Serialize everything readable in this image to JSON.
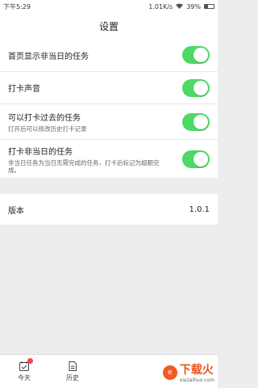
{
  "status": {
    "time": "下午5:29",
    "network_speed": "1.01K/s",
    "battery": "39%"
  },
  "header": {
    "title": "设置"
  },
  "settings": [
    {
      "title": "首页显示非当日的任务",
      "desc": "",
      "on": true
    },
    {
      "title": "打卡声音",
      "desc": "",
      "on": true
    },
    {
      "title": "可以打卡过去的任务",
      "desc": "打开后可以修改历史打卡记录",
      "on": true
    },
    {
      "title": "打卡非当日的任务",
      "desc": "非当日任务为当日无需完成的任务，打卡后标记为超额完成。",
      "on": true
    }
  ],
  "version": {
    "label": "版本",
    "value": "1.0.1"
  },
  "tabs": [
    {
      "label": "今天",
      "icon": "calendar-check-icon",
      "badge": true
    },
    {
      "label": "历史",
      "icon": "history-doc-icon",
      "badge": false
    }
  ],
  "watermark": {
    "cn": "下载火",
    "en": "xiazaihuo.com"
  },
  "colors": {
    "toggle_on": "#4cd964",
    "badge": "#ff4444",
    "watermark": "#e8541d"
  }
}
